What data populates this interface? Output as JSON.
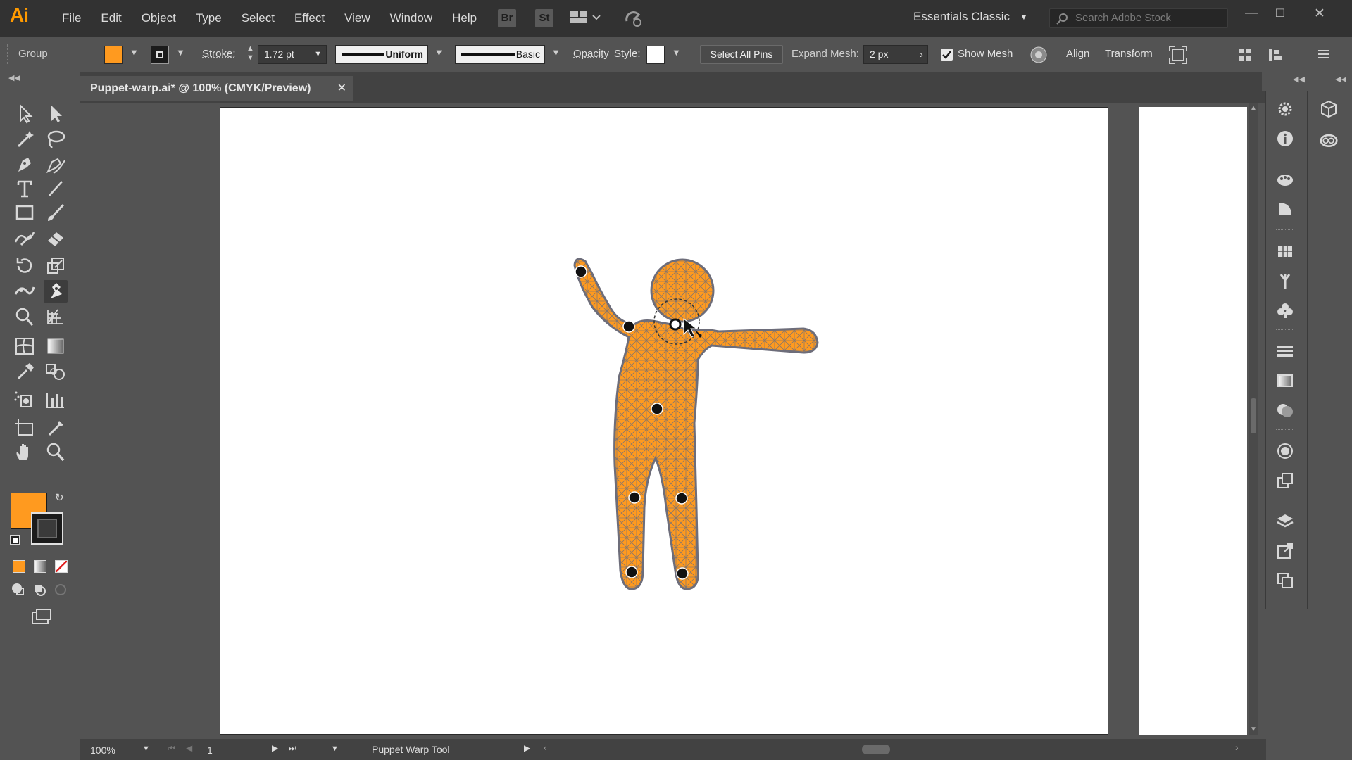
{
  "app": {
    "logo": "Ai",
    "workspace": "Essentials Classic",
    "search_placeholder": "Search Adobe Stock",
    "menu": [
      "File",
      "Edit",
      "Object",
      "Type",
      "Select",
      "Effect",
      "View",
      "Window",
      "Help"
    ],
    "bridge": "Br",
    "stock": "St"
  },
  "control": {
    "selection_type": "Group",
    "fill_color": "#FF9A1F",
    "stroke_label": "Stroke:",
    "stroke_weight": "1.72 pt",
    "profile_label": "Uniform",
    "brush_label": "Basic",
    "opacity_label": "Opacity",
    "style_label": "Style:",
    "select_all_pins": "Select All Pins",
    "expand_mesh_label": "Expand Mesh:",
    "expand_mesh_value": "2 px",
    "show_mesh_label": "Show Mesh",
    "align_label": "Align",
    "transform_label": "Transform"
  },
  "document": {
    "tab_title": "Puppet-warp.ai* @ 100% (CMYK/Preview)"
  },
  "status": {
    "zoom": "100%",
    "artboard": "1",
    "tool_name": "Puppet Warp Tool"
  },
  "colors": {
    "fill": "#FF9A1F",
    "mesh": "#6d6d7a",
    "pin": "#111111"
  }
}
